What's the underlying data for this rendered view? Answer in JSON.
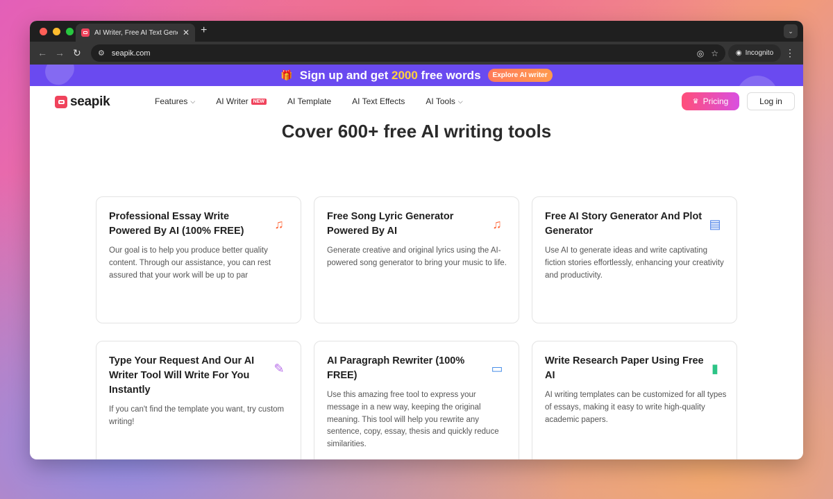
{
  "browser": {
    "tab_title": "AI Writer, Free AI Text Genera",
    "url": "seapik.com",
    "incognito_label": "Incognito"
  },
  "banner": {
    "text_before": "Sign up and get ",
    "highlight": "2000",
    "text_after": " free words",
    "cta": "Explore AI writer"
  },
  "header": {
    "logo": "seapik",
    "nav": {
      "features": "Features",
      "ai_writer": "AI Writer",
      "ai_writer_badge": "NEW",
      "ai_template": "AI Template",
      "ai_text_effects": "AI Text Effects",
      "ai_tools": "AI Tools"
    },
    "pricing": "Pricing",
    "login": "Log in"
  },
  "hero": {
    "title": "Cover 600+ free AI writing tools"
  },
  "cards": [
    {
      "title": "Professional Essay Write Powered By AI (100% FREE)",
      "desc": "Our goal is to help you produce better quality content. Through our assistance, you can rest assured that your work will be up to par",
      "icon": "music-note-icon"
    },
    {
      "title": "Free Song Lyric Generator Powered By AI",
      "desc": "Generate creative and original lyrics using the AI-powered song generator to bring your music to life.",
      "icon": "music-note-icon"
    },
    {
      "title": "Free AI Story Generator And Plot Generator",
      "desc": "Use AI to generate ideas and write captivating fiction stories effortlessly, enhancing your creativity and productivity.",
      "icon": "open-book-icon"
    },
    {
      "title": "Type Your Request And Our AI Writer Tool Will Write For You Instantly",
      "desc": "If you can't find the template you want, try custom writing!",
      "icon": "pen-document-icon"
    },
    {
      "title": "AI Paragraph Rewriter (100% FREE)",
      "desc": "Use this amazing free tool to express your message in a new way, keeping the original meaning. This tool will help you rewrite any sentence, copy, essay, thesis and quickly reduce similarities.",
      "icon": "edit-card-icon"
    },
    {
      "title": "Write Research Paper Using Free AI",
      "desc": "AI writing templates can be customized for all types of essays, making it easy to write high-quality academic papers.",
      "icon": "document-star-icon"
    }
  ]
}
